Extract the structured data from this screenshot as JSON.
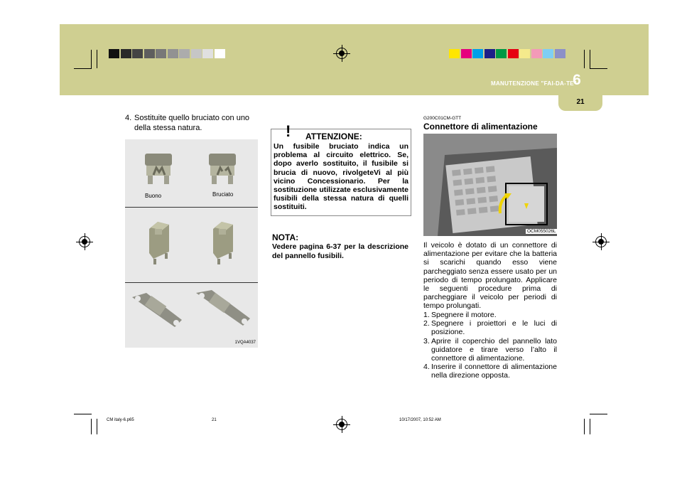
{
  "header": {
    "section_label": "MANUTENZIONE \"FAI-DA-TE\"",
    "chapter_number": "6",
    "page_number": "21"
  },
  "left_column": {
    "step_number": "4.",
    "step_text": "Sostituite quello bruciato con uno della stessa natura.",
    "figure": {
      "label_good": "Buono",
      "label_blown": "Bruciato",
      "code": "1VQA4037"
    }
  },
  "warning": {
    "icon": "exclamation-icon",
    "title": "ATTENZIONE:",
    "text": "Un fusibile bruciato indica un problema al circuito elettrico. Se, dopo averlo sostituito, il fusibile si brucia di nuovo, rivolgeteVi al più vicino Concessionario. Per la sostituzione utilizzate esclusivamente fusibili della stessa natura di quelli sostituiti."
  },
  "note": {
    "title": "NOTA:",
    "text": "Vedere pagina 6-37 per la descrizione del pannello fusibili."
  },
  "right_column": {
    "code": "G200C01CM-GTT",
    "heading": "Connettore di alimentazione",
    "photo_code": "OCM055026L",
    "body": "Il veicolo è dotato di un connettore di alimentazione per evitare che la batteria si scarichi quando esso viene parcheggiato senza essere usato per un periodo di tempo prolungato. Applicare le seguenti procedure prima di parcheggiare il veicolo per periodi di tempo prolungati.",
    "steps": [
      {
        "n": "1.",
        "text": "Spegnere il motore."
      },
      {
        "n": "2.",
        "text": "Spegnere i proiettori e le luci di posizione."
      },
      {
        "n": "3.",
        "text": "Aprire il coperchio del pannello lato guidatore e tirare verso l’alto il connettore di alimentazione."
      },
      {
        "n": "4.",
        "text": "Inserire il connettore di alimentazione nella direzione opposta."
      }
    ]
  },
  "footer": {
    "file": "CM italy-6.p65",
    "page": "21",
    "timestamp": "10/17/2007, 10:52 AM"
  },
  "colors": {
    "band": "#cfcf91",
    "gray_strip": [
      "#111111",
      "#2a2a2a",
      "#444444",
      "#5e5e5e",
      "#787878",
      "#929292",
      "#acacac",
      "#c6c6c6",
      "#e0e0e0",
      "#ffffff"
    ],
    "color_strip": [
      "#ffe600",
      "#e6007e",
      "#00a0e9",
      "#1d2088",
      "#009944",
      "#e60012",
      "#f5ea8c",
      "#f39ab8",
      "#7fcef4",
      "#8c90c8"
    ]
  }
}
